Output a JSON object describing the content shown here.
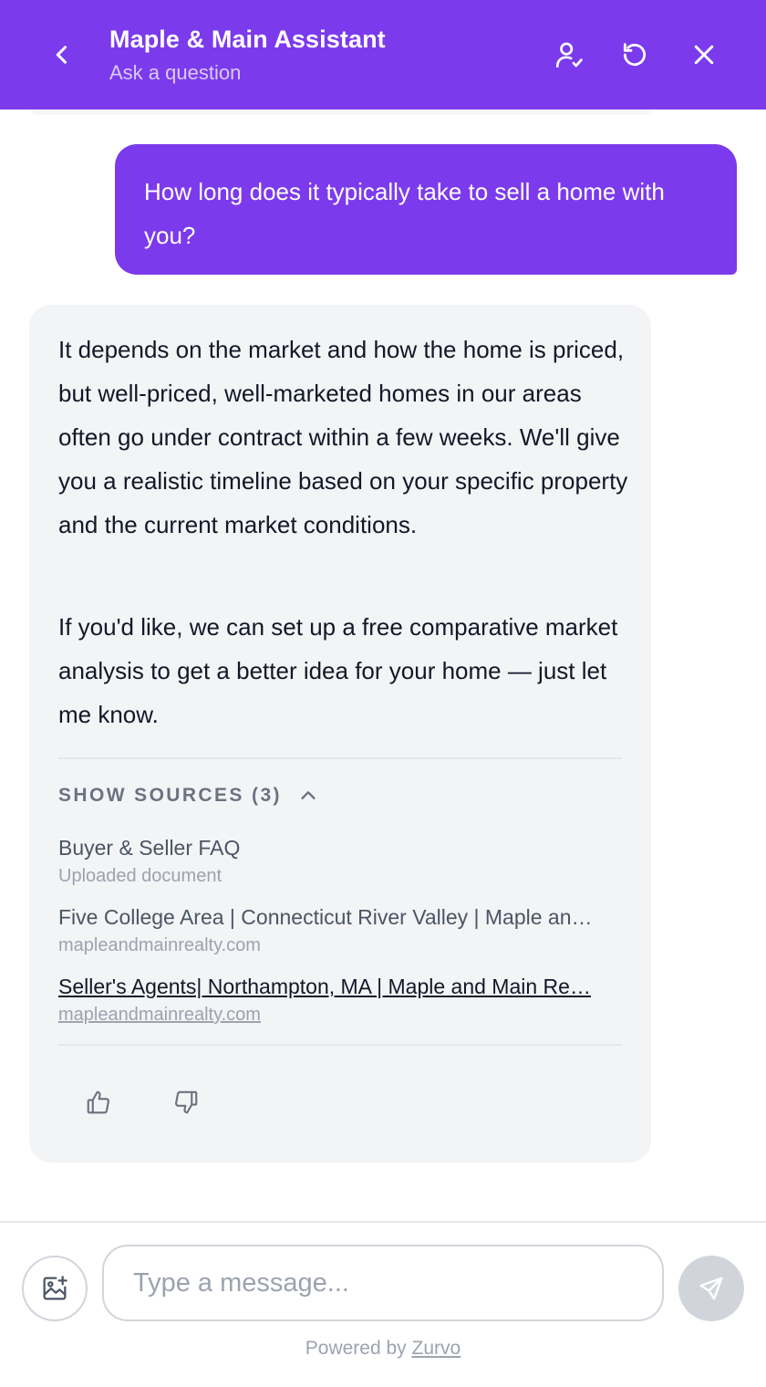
{
  "header": {
    "title": "Maple & Main Assistant",
    "subtitle": "Ask a question",
    "background": "#7c3aed",
    "icons": {
      "back": "chevron-left-icon",
      "agent": "user-check-icon",
      "reset": "refresh-icon",
      "close": "close-icon"
    }
  },
  "conversation": {
    "user_message": "How long does it typically take to sell a home with you?",
    "bot_message": {
      "paragraphs": [
        "It depends on the market and how the home is priced, but well-priced, well-marketed homes in our areas often go under contract within a few weeks. We'll give you a realistic timeline based on your specific property and the current market conditions.",
        "If you'd like, we can set up a free comparative market analysis to get a better idea for your home — just let me know."
      ],
      "sources_toggle_label": "SHOW SOURCES (3)",
      "sources": [
        {
          "name": "Buyer & Seller FAQ",
          "meta": "Uploaded document"
        },
        {
          "name": "Five College Area | Connecticut River Valley | Maple an…",
          "meta": "mapleandmainrealty.com"
        },
        {
          "name": "Seller's Agents| Northampton, MA | Maple and Main Re…",
          "meta": "mapleandmainrealty.com"
        }
      ],
      "feedback_icons": [
        "thumbs-up-icon",
        "thumbs-down-icon"
      ]
    }
  },
  "composer": {
    "placeholder": "Type a message...",
    "attach_icon": "image-add-icon",
    "send_icon": "send-icon"
  },
  "footer": {
    "powered_prefix": "Powered by ",
    "powered_link": "Zurvo"
  }
}
